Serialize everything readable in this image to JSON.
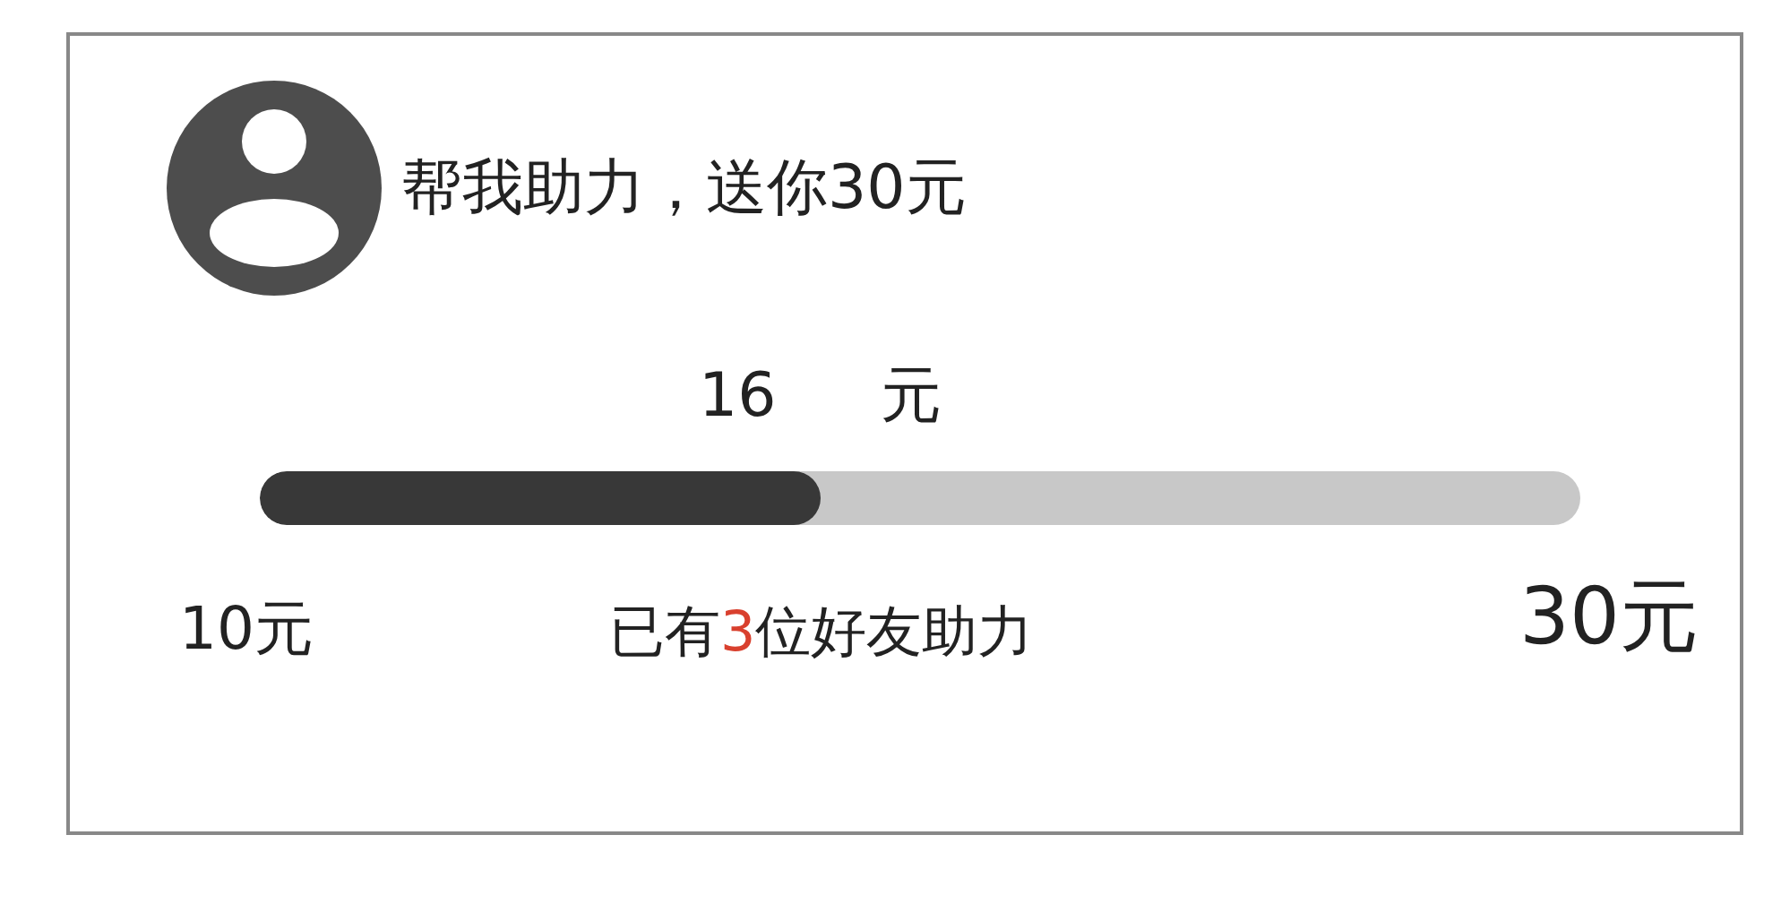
{
  "card": {
    "title": "帮我助力，送你30元",
    "amount": {
      "value": "16",
      "unit": "元"
    },
    "progress": {
      "level": 0.425
    },
    "min_label": "10元",
    "helpers": {
      "prefix": "已有",
      "count": "3",
      "suffix": "位好友助力"
    },
    "max_label": "30元"
  }
}
